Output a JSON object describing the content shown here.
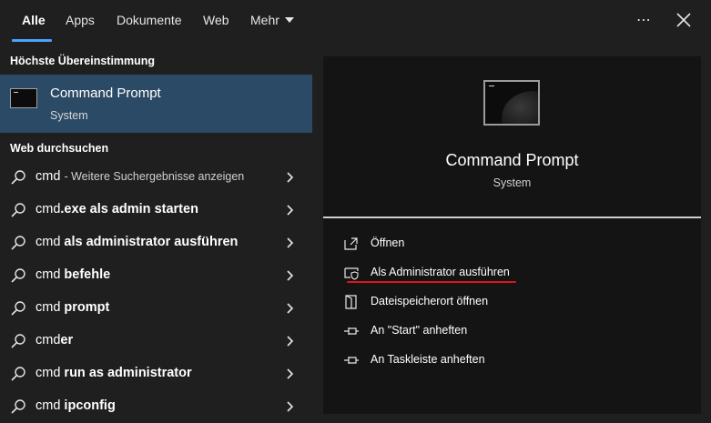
{
  "tabs": [
    {
      "label": "Alle",
      "active": true
    },
    {
      "label": "Apps"
    },
    {
      "label": "Dokumente"
    },
    {
      "label": "Web"
    },
    {
      "label": "Mehr"
    }
  ],
  "best_match": {
    "section_title": "Höchste Übereinstimmung",
    "title": "Command Prompt",
    "subtitle": "System"
  },
  "web_search": {
    "section_title": "Web durchsuchen",
    "results": [
      {
        "prefix": "cmd",
        "suffix": "",
        "hint": "- Weitere Suchergebnisse anzeigen"
      },
      {
        "prefix": "cmd",
        "suffix": ".exe als admin starten",
        "hint": ""
      },
      {
        "prefix": "cmd",
        "suffix": " als administrator ausführen",
        "hint": ""
      },
      {
        "prefix": "cmd",
        "suffix": " befehle",
        "hint": ""
      },
      {
        "prefix": "cmd",
        "suffix": " prompt",
        "hint": ""
      },
      {
        "prefix": "cmd",
        "suffix": "er",
        "hint": ""
      },
      {
        "prefix": "cmd",
        "suffix": " run as administrator",
        "hint": ""
      },
      {
        "prefix": "cmd",
        "suffix": " ipconfig",
        "hint": ""
      }
    ]
  },
  "detail": {
    "title": "Command Prompt",
    "subtitle": "System",
    "actions": [
      {
        "label": "Öffnen",
        "icon": "open-icon"
      },
      {
        "label": "Als Administrator ausführen",
        "icon": "shield-icon"
      },
      {
        "label": "Dateispeicherort öffnen",
        "icon": "folder-icon"
      },
      {
        "label": "An \"Start\" anheften",
        "icon": "pin-icon"
      },
      {
        "label": "An Taskleiste anheften",
        "icon": "pin-icon"
      }
    ]
  },
  "colors": {
    "accent": "#4aa3ff",
    "selection": "#2b4a66",
    "highlight_underline": "#e0141e"
  }
}
